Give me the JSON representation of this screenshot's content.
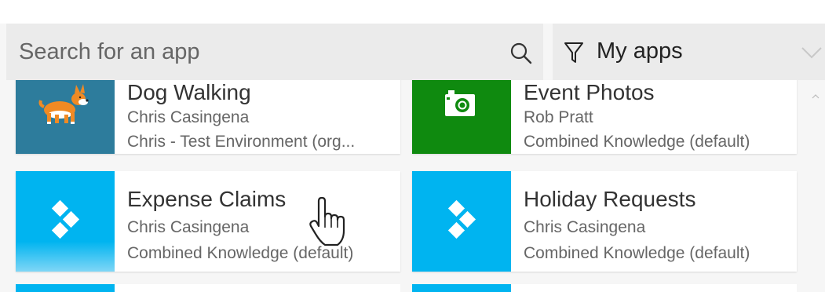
{
  "search": {
    "placeholder": "Search for an app"
  },
  "filter": {
    "label": "My apps"
  },
  "apps": [
    {
      "name": "Dog Walking",
      "owner": "Chris Casingena",
      "environment": "Chris - Test Environment (org...",
      "icon": "dog-icon",
      "color": "#2d7c9c"
    },
    {
      "name": "Event Photos",
      "owner": "Rob Pratt",
      "environment": "Combined Knowledge (default)",
      "icon": "camera-icon",
      "color": "#0f8a0f"
    },
    {
      "name": "Expense Claims",
      "owner": "Chris Casingena",
      "environment": "Combined Knowledge (default)",
      "icon": "powerapps-icon",
      "color": "#00b4f0"
    },
    {
      "name": "Holiday Requests",
      "owner": "Chris Casingena",
      "environment": "Combined Knowledge (default)",
      "icon": "powerapps-icon",
      "color": "#00b4f0"
    }
  ],
  "colors": {
    "search_bg": "#ebebeb",
    "tile_blue": "#00b4f0",
    "tile_green": "#0f8a0f",
    "tile_teal": "#2d7c9c"
  }
}
